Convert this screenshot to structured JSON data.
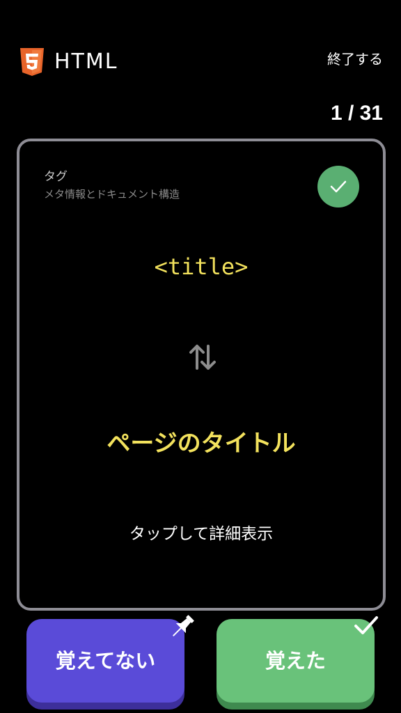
{
  "header": {
    "logo_icon": "html5-logo-icon",
    "logo_color": "#e8642a",
    "title": "HTML",
    "quit_label": "終了する",
    "progress": "1 / 31"
  },
  "card": {
    "category": "タグ",
    "subcategory": "メタ情報とドキュメント構造",
    "check_icon": "check-icon",
    "check_color": "#5aaf72",
    "term": "<title>",
    "swap_icon": "swap-vertical-icon",
    "meaning": "ページのタイトル",
    "tap_hint": "タップして詳細表示",
    "accent_color": "#f3e25d",
    "border_color": "#8e8d95"
  },
  "actions": {
    "not_learned_label": "覚えてない",
    "not_learned_color": "#5a4bd8",
    "not_learned_icon": "pin-icon",
    "learned_label": "覚えた",
    "learned_color": "#69c27a",
    "learned_icon": "check-icon"
  }
}
